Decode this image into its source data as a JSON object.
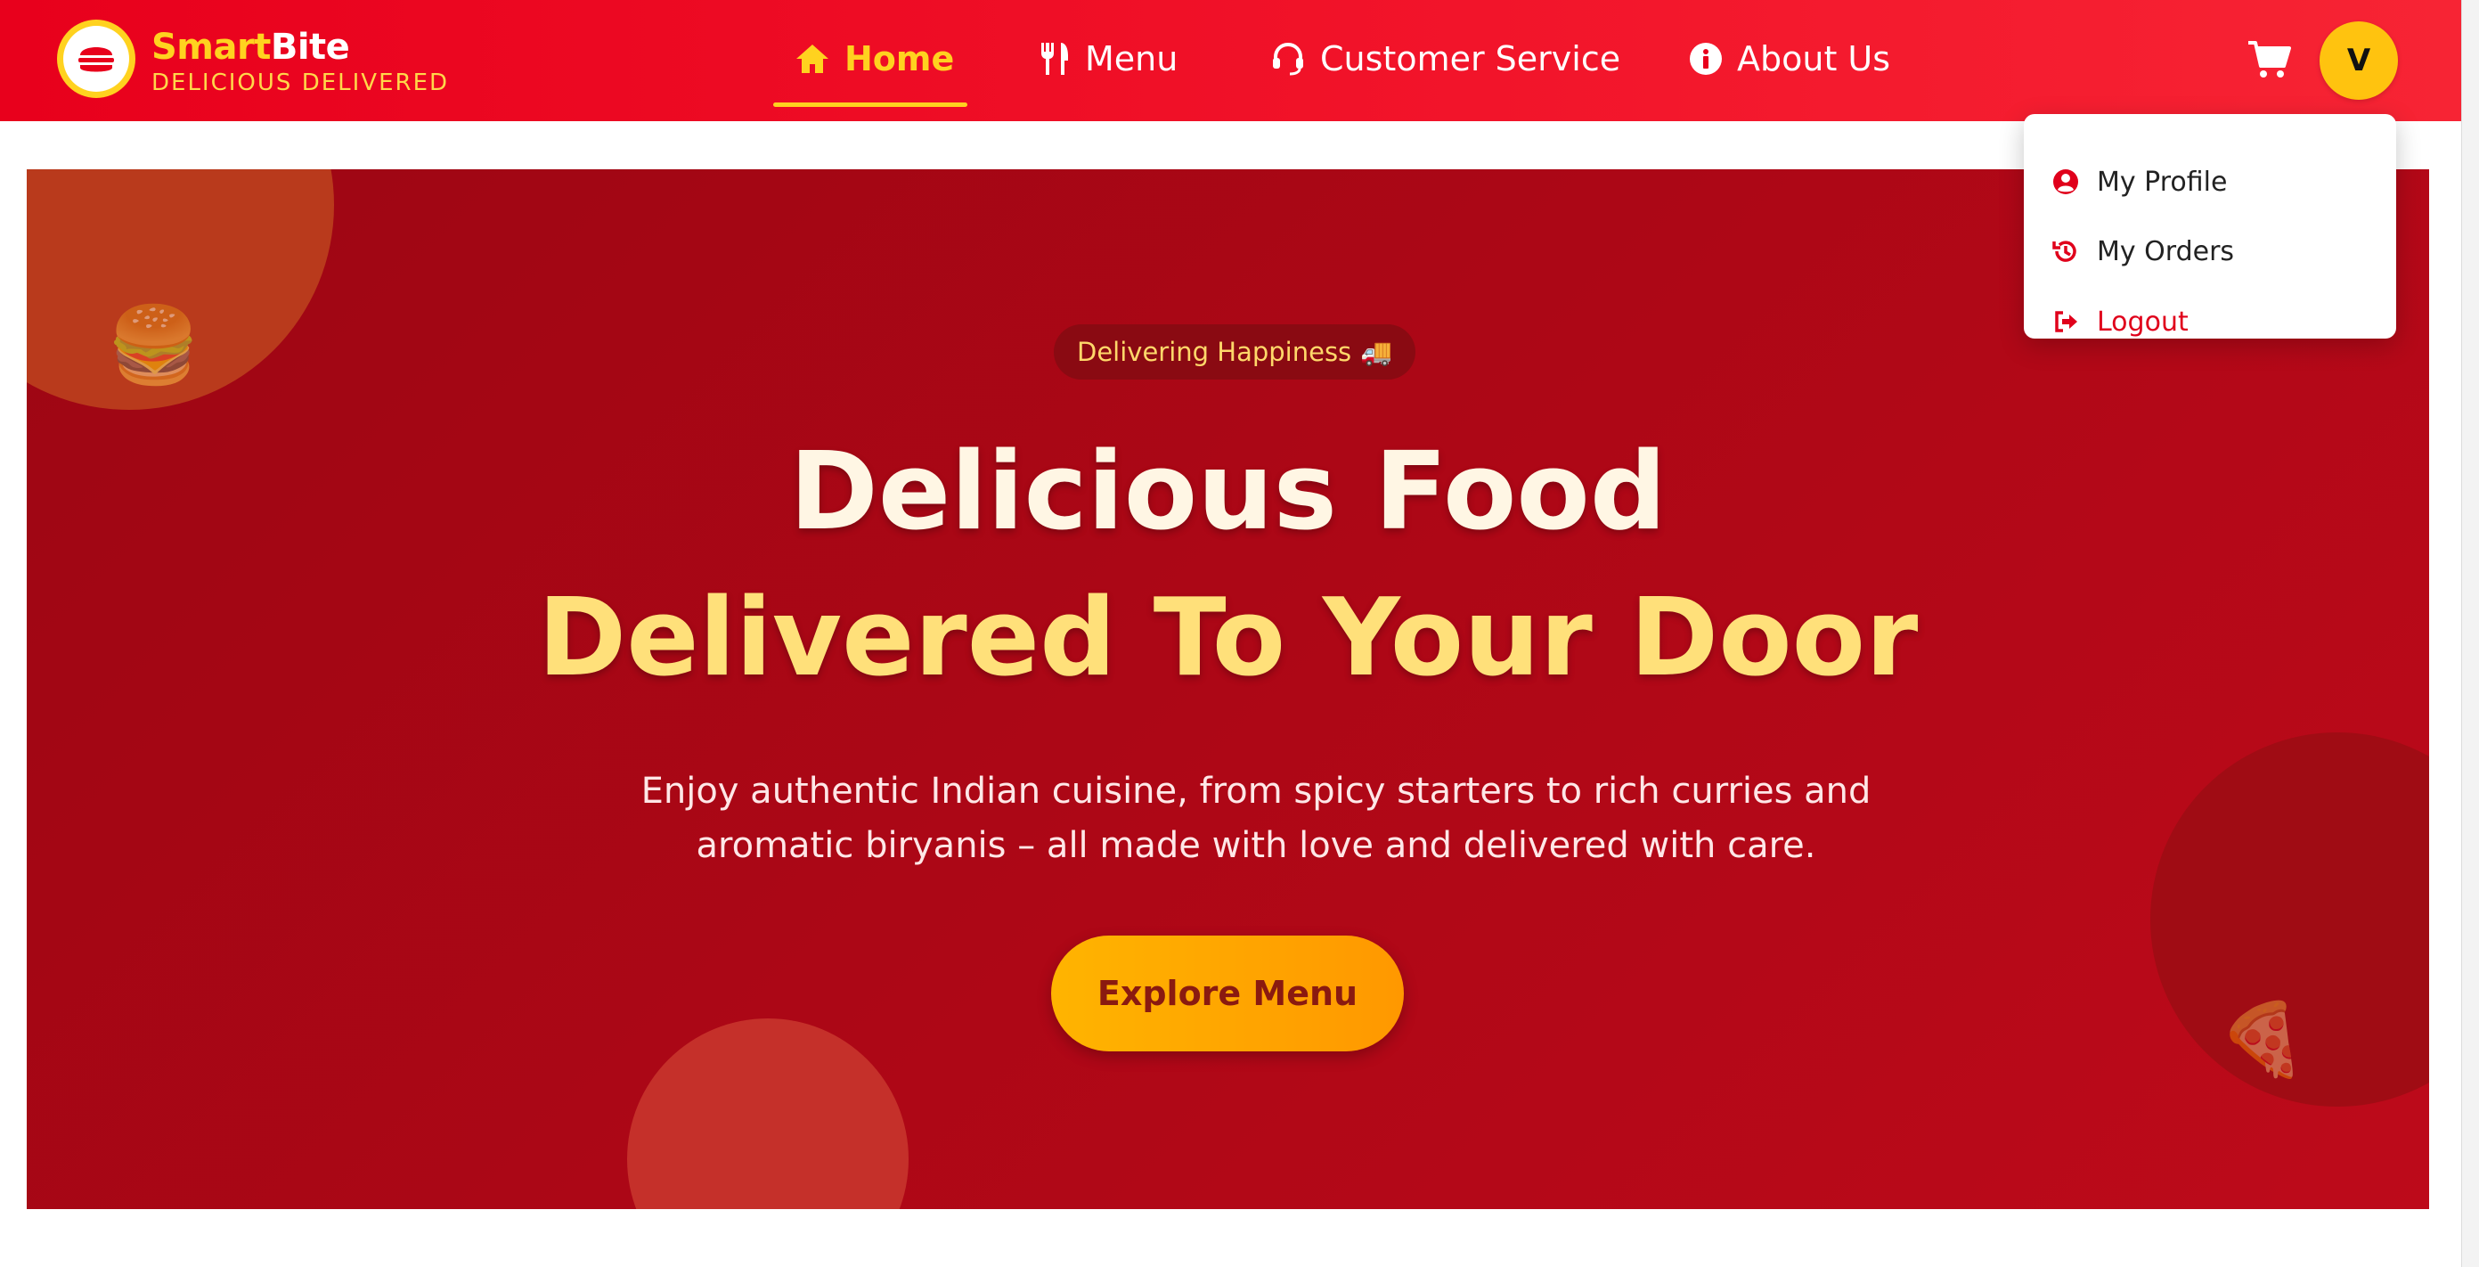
{
  "brand": {
    "name_part1": "Smart",
    "name_part2": "Bite",
    "tagline": "DELICIOUS DELIVERED",
    "logo_icon": "burger-icon"
  },
  "nav": {
    "items": [
      {
        "label": "Home",
        "icon": "home-icon",
        "active": true
      },
      {
        "label": "Menu",
        "icon": "utensils-icon",
        "active": false
      },
      {
        "label": "Customer Service",
        "icon": "headset-icon",
        "active": false
      },
      {
        "label": "About Us",
        "icon": "info-icon",
        "active": false
      }
    ]
  },
  "header": {
    "cart_icon": "cart-icon",
    "avatar_initial": "V"
  },
  "dropdown": {
    "items": [
      {
        "label": "My Profile",
        "icon": "user-circle-icon"
      },
      {
        "label": "My Orders",
        "icon": "history-icon"
      },
      {
        "label": "Logout",
        "icon": "logout-icon"
      }
    ]
  },
  "hero": {
    "badge": "Delivering Happiness",
    "badge_emoji": "🚚",
    "title_line1": "Delicious Food",
    "title_line2": "Delivered To Your Door",
    "description_line1": "Enjoy authentic Indian cuisine, from spicy starters to rich curries and",
    "description_line2": "aromatic biryanis – all made with love and delivered with care.",
    "cta_label": "Explore Menu",
    "decor_emoji_1": "🍔",
    "decor_emoji_2": "🍕"
  },
  "colors": {
    "primary_red": "#e8001c",
    "accent_yellow": "#ffd21f",
    "hero_red": "#ad0716",
    "cta_orange": "#ffa600"
  }
}
